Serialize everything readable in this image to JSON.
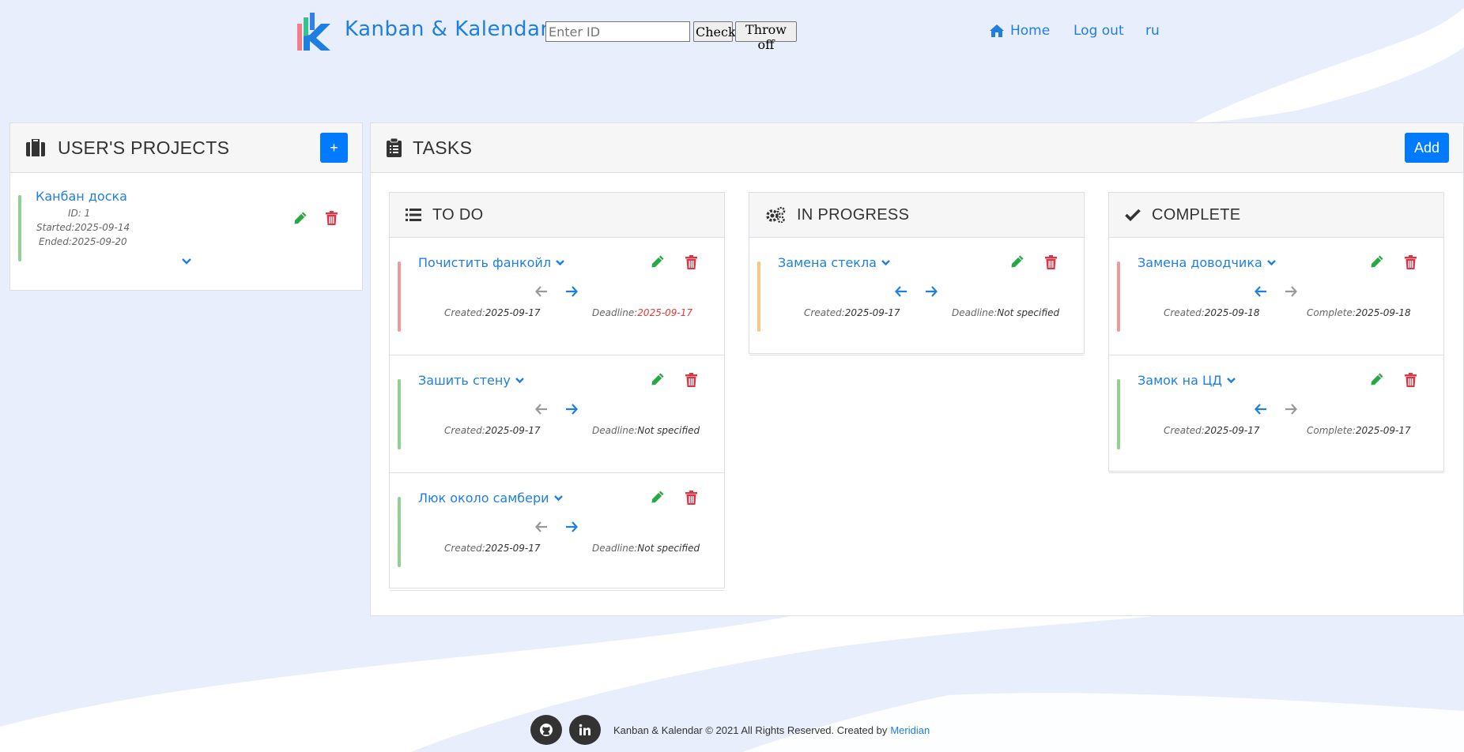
{
  "header": {
    "brand": "Kanban & Kalendar",
    "id_placeholder": "Enter ID",
    "check_label": "Check",
    "throw_label": "Throw off",
    "nav": {
      "home": "Home",
      "logout": "Log out",
      "lang": "ru"
    }
  },
  "projects": {
    "title": "USER'S PROJECTS",
    "add_label": "+",
    "items": [
      {
        "name": "Канбан доска",
        "id_label": "ID: 1",
        "started_label": "Started:",
        "started": "2025-09-14",
        "ended_label": "Ended:",
        "ended": "2025-09-20"
      }
    ]
  },
  "tasks": {
    "title": "TASKS",
    "add_label": "Add",
    "columns": [
      {
        "title": "TO DO",
        "items": [
          {
            "title": "Почистить фанкойл",
            "bar_color": "#ef9a9a",
            "created_label": "Created:",
            "created": "2025-09-17",
            "right_label": "Deadline:",
            "right_value": "2025-09-17"
          },
          {
            "title": "Зашить стену",
            "bar_color": "#8fd18f",
            "created_label": "Created:",
            "created": "2025-09-17",
            "right_label": "Deadline:",
            "right_value": "Not specified"
          },
          {
            "title": "Люк около самбери",
            "bar_color": "#8fd18f",
            "created_label": "Created:",
            "created": "2025-09-17",
            "right_label": "Deadline:",
            "right_value": "Not specified"
          }
        ]
      },
      {
        "title": "IN PROGRESS",
        "items": [
          {
            "title": "Замена стекла",
            "bar_color": "#f5c98a",
            "created_label": "Created:",
            "created": "2025-09-17",
            "right_label": "Deadline:",
            "right_value": "Not specified"
          }
        ]
      },
      {
        "title": "COMPLETE",
        "items": [
          {
            "title": "Замена доводчика",
            "bar_color": "#ef9a9a",
            "created_label": "Created:",
            "created": "2025-09-18",
            "right_label": "Complete:",
            "right_value": "2025-09-18"
          },
          {
            "title": "Замок на ЦД",
            "bar_color": "#8fd18f",
            "created_label": "Created:",
            "created": "2025-09-17",
            "right_label": "Complete:",
            "right_value": "2025-09-17"
          }
        ]
      }
    ]
  },
  "footer": {
    "text": "Kanban & Kalendar © 2021 All Rights Reserved. Created by",
    "link": "Meridian"
  },
  "colors": {
    "accent": "#007bff",
    "link": "#1e7fe0",
    "edit": "#28a745",
    "delete": "#dc3545",
    "deadline_overdue": "#e53935",
    "background": "#e8eefb"
  },
  "icons": [
    "home-icon",
    "briefcase-icon",
    "clipboard-icon",
    "list-icon",
    "cogs-icon",
    "check-icon",
    "pencil-icon",
    "trash-icon",
    "chevron-down-icon",
    "arrow-left-icon",
    "arrow-right-icon",
    "github-icon",
    "linkedin-icon"
  ]
}
